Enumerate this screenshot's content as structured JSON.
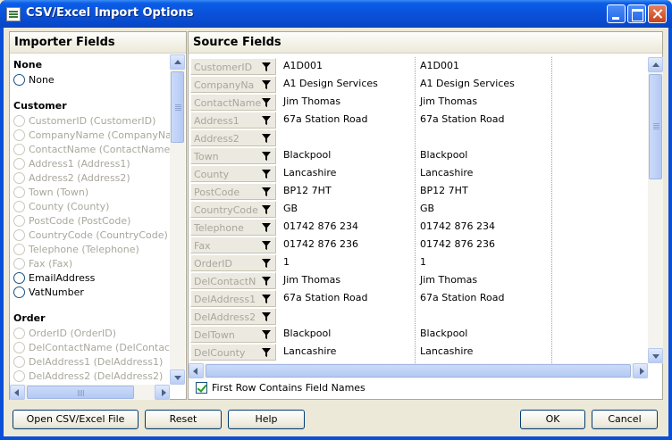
{
  "window": {
    "title": "CSV/Excel Import Options"
  },
  "importer": {
    "heading": "Importer Fields",
    "groups": [
      {
        "title": "None",
        "items": [
          {
            "label": "None",
            "enabled": true
          }
        ]
      },
      {
        "title": "Customer",
        "items": [
          {
            "label": "CustomerID (CustomerID)",
            "enabled": false
          },
          {
            "label": "CompanyName (CompanyNa",
            "enabled": false
          },
          {
            "label": "ContactName (ContactName)",
            "enabled": false
          },
          {
            "label": "Address1 (Address1)",
            "enabled": false
          },
          {
            "label": "Address2 (Address2)",
            "enabled": false
          },
          {
            "label": "Town (Town)",
            "enabled": false
          },
          {
            "label": "County (County)",
            "enabled": false
          },
          {
            "label": "PostCode (PostCode)",
            "enabled": false
          },
          {
            "label": "CountryCode (CountryCode)",
            "enabled": false
          },
          {
            "label": "Telephone (Telephone)",
            "enabled": false
          },
          {
            "label": "Fax (Fax)",
            "enabled": false
          },
          {
            "label": "EmailAddress",
            "enabled": true
          },
          {
            "label": "VatNumber",
            "enabled": true
          }
        ]
      },
      {
        "title": "Order",
        "items": [
          {
            "label": "OrderID (OrderID)",
            "enabled": false
          },
          {
            "label": "DelContactName (DelContact",
            "enabled": false
          },
          {
            "label": "DelAddress1 (DelAddress1)",
            "enabled": false
          },
          {
            "label": "DelAddress2 (DelAddress2)",
            "enabled": false
          }
        ]
      }
    ]
  },
  "source": {
    "heading": "Source Fields",
    "rows": [
      {
        "field": "CustomerID",
        "v1": "A1D001",
        "v2": "A1D001"
      },
      {
        "field": "CompanyNa",
        "v1": "A1 Design Services",
        "v2": "A1 Design Services"
      },
      {
        "field": "ContactName",
        "v1": "Jim Thomas",
        "v2": "Jim Thomas"
      },
      {
        "field": "Address1",
        "v1": "67a Station Road",
        "v2": "67a Station Road"
      },
      {
        "field": "Address2",
        "v1": "",
        "v2": ""
      },
      {
        "field": "Town",
        "v1": "Blackpool",
        "v2": "Blackpool"
      },
      {
        "field": "County",
        "v1": "Lancashire",
        "v2": "Lancashire"
      },
      {
        "field": "PostCode",
        "v1": "BP12 7HT",
        "v2": "BP12 7HT"
      },
      {
        "field": "CountryCode",
        "v1": "GB",
        "v2": "GB"
      },
      {
        "field": "Telephone",
        "v1": "01742 876 234",
        "v2": "01742 876 234"
      },
      {
        "field": "Fax",
        "v1": "01742 876 236",
        "v2": "01742 876 236"
      },
      {
        "field": "OrderID",
        "v1": "1",
        "v2": "1"
      },
      {
        "field": "DelContactN",
        "v1": "Jim Thomas",
        "v2": "Jim Thomas"
      },
      {
        "field": "DelAddress1",
        "v1": "67a Station Road",
        "v2": "67a Station Road"
      },
      {
        "field": "DelAddress2",
        "v1": "",
        "v2": ""
      },
      {
        "field": "DelTown",
        "v1": "Blackpool",
        "v2": "Blackpool"
      },
      {
        "field": "DelCounty",
        "v1": "Lancashire",
        "v2": "Lancashire"
      }
    ],
    "first_row_label": "First Row Contains Field Names",
    "first_row_checked": true
  },
  "buttons": {
    "open": "Open CSV/Excel File",
    "reset": "Reset",
    "help": "Help",
    "ok": "OK",
    "cancel": "Cancel"
  },
  "colors": {
    "titlebar": "#0a50d8",
    "disabled_text": "#a9a79d",
    "face": "#ece9d8"
  }
}
